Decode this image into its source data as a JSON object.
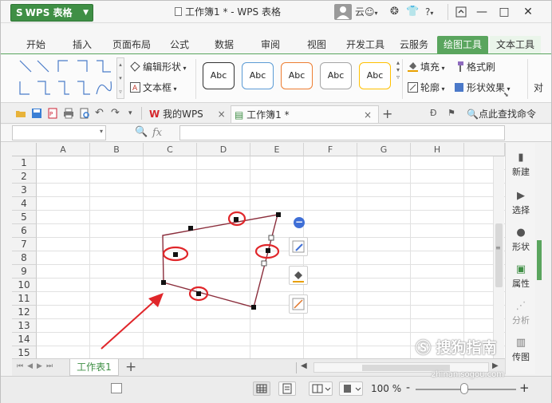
{
  "app": {
    "menu_label": "WPS 表格",
    "logo": "S",
    "title": "工作簿1 * - WPS 表格",
    "user_label": "云",
    "help_label": "?"
  },
  "ribbon_tabs": [
    "开始",
    "插入",
    "页面布局",
    "公式",
    "数据",
    "审阅",
    "视图",
    "开发工具",
    "云服务",
    "绘图工具",
    "文本工具"
  ],
  "ribbon": {
    "edit_shape_label": "编辑形状",
    "textbox_label": "文本框",
    "abc_label": "Abc",
    "style_colors": [
      "#333333",
      "#5b9bd5",
      "#ed7d31",
      "#a5a5a5",
      "#ffc000"
    ],
    "fill_label": "填充",
    "format_painter_label": "格式刷",
    "outline_label": "轮廓",
    "shape_effect_label": "形状效果",
    "overflow_label": "对"
  },
  "doc_tabs": {
    "my_wps_label": "我的WPS",
    "workbook_label": "工作簿1 *",
    "search_label": "点此查找命令"
  },
  "formula_bar": {
    "fx_label": "fx"
  },
  "grid": {
    "columns": [
      "A",
      "B",
      "C",
      "D",
      "E",
      "F",
      "G",
      "H"
    ],
    "rows": [
      "1",
      "2",
      "3",
      "4",
      "5",
      "6",
      "7",
      "8",
      "9",
      "10",
      "11",
      "12",
      "13",
      "14",
      "15"
    ]
  },
  "right_panel": [
    {
      "label": "新建",
      "icon": "new-icon"
    },
    {
      "label": "选择",
      "icon": "select-icon"
    },
    {
      "label": "形状",
      "icon": "shape-icon"
    },
    {
      "label": "属性",
      "icon": "property-icon"
    },
    {
      "label": "分析",
      "icon": "analysis-icon"
    },
    {
      "label": "传图",
      "icon": "upload-image-icon"
    }
  ],
  "sheet_tabs": {
    "active_sheet": "工作表1",
    "add_label": "+"
  },
  "status": {
    "zoom_label": "100 %",
    "zoom_minus": "-",
    "zoom_plus": "+"
  },
  "watermark": {
    "text": "搜狗指南",
    "url": "zhinan.sogou.com"
  },
  "colors": {
    "accent_green": "#5aa55e",
    "shape_line": "#8b2e3c",
    "annotation_red": "#e0262a",
    "float_icon_blue": "#3f6fd6"
  }
}
